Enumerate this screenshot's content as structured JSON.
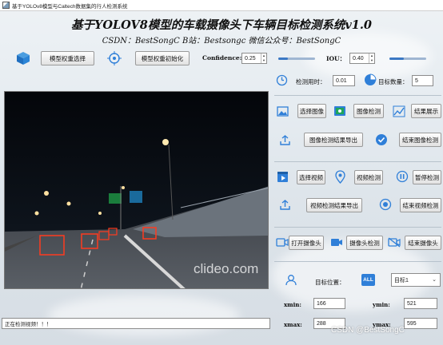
{
  "window": {
    "title": "基于YOLOv8模型与Caltech数据集的行人检测系统"
  },
  "header": {
    "title": "基于YOLOV8模型的车载摄像头下车辆目标检测系统v1.0",
    "subtitle": "CSDN：BestSongC  B站：Bestsongc  微信公众号：BestSongC"
  },
  "toolbar": {
    "model_select": "模型权重选择",
    "model_init": "模型权重初始化",
    "confidence_label": "Confidence:",
    "confidence_value": "0.25",
    "confidence_level": 0.25,
    "iou_label": "IOU：",
    "iou_value": "0.40",
    "iou_level": 0.4
  },
  "stats": {
    "time_label": "检测用时：",
    "time_value": "0.01",
    "count_label": "目标数量：",
    "count_value": "5"
  },
  "image_section": {
    "select": "选择图像",
    "detect": "图像检测",
    "show": "结果展示",
    "export": "图像检测结果导出",
    "stop": "结束图像检测"
  },
  "video_section": {
    "select": "选择视频",
    "detect": "视频检测",
    "pause": "暂停检测",
    "export": "视频检测结果导出",
    "stop": "结束视频检测"
  },
  "camera_section": {
    "open": "打开摄像头",
    "detect": "摄像头检测",
    "stop": "结束摄像头"
  },
  "target": {
    "label": "目标位置：",
    "all_badge": "ALL",
    "selected": "目标1",
    "xmin_label": "xmin:",
    "xmin": "166",
    "ymin_label": "ymin:",
    "ymin": "521",
    "xmax_label": "xmax:",
    "xmax": "288",
    "ymax_label": "ymax:",
    "ymax": "595"
  },
  "video": {
    "watermark": "clideo.com"
  },
  "status": {
    "text": "正在检测视频！！！"
  },
  "watermark": "CSDN @BestSongC",
  "colors": {
    "accent": "#2f7fd8",
    "detect_box": "#ff3b1f"
  }
}
